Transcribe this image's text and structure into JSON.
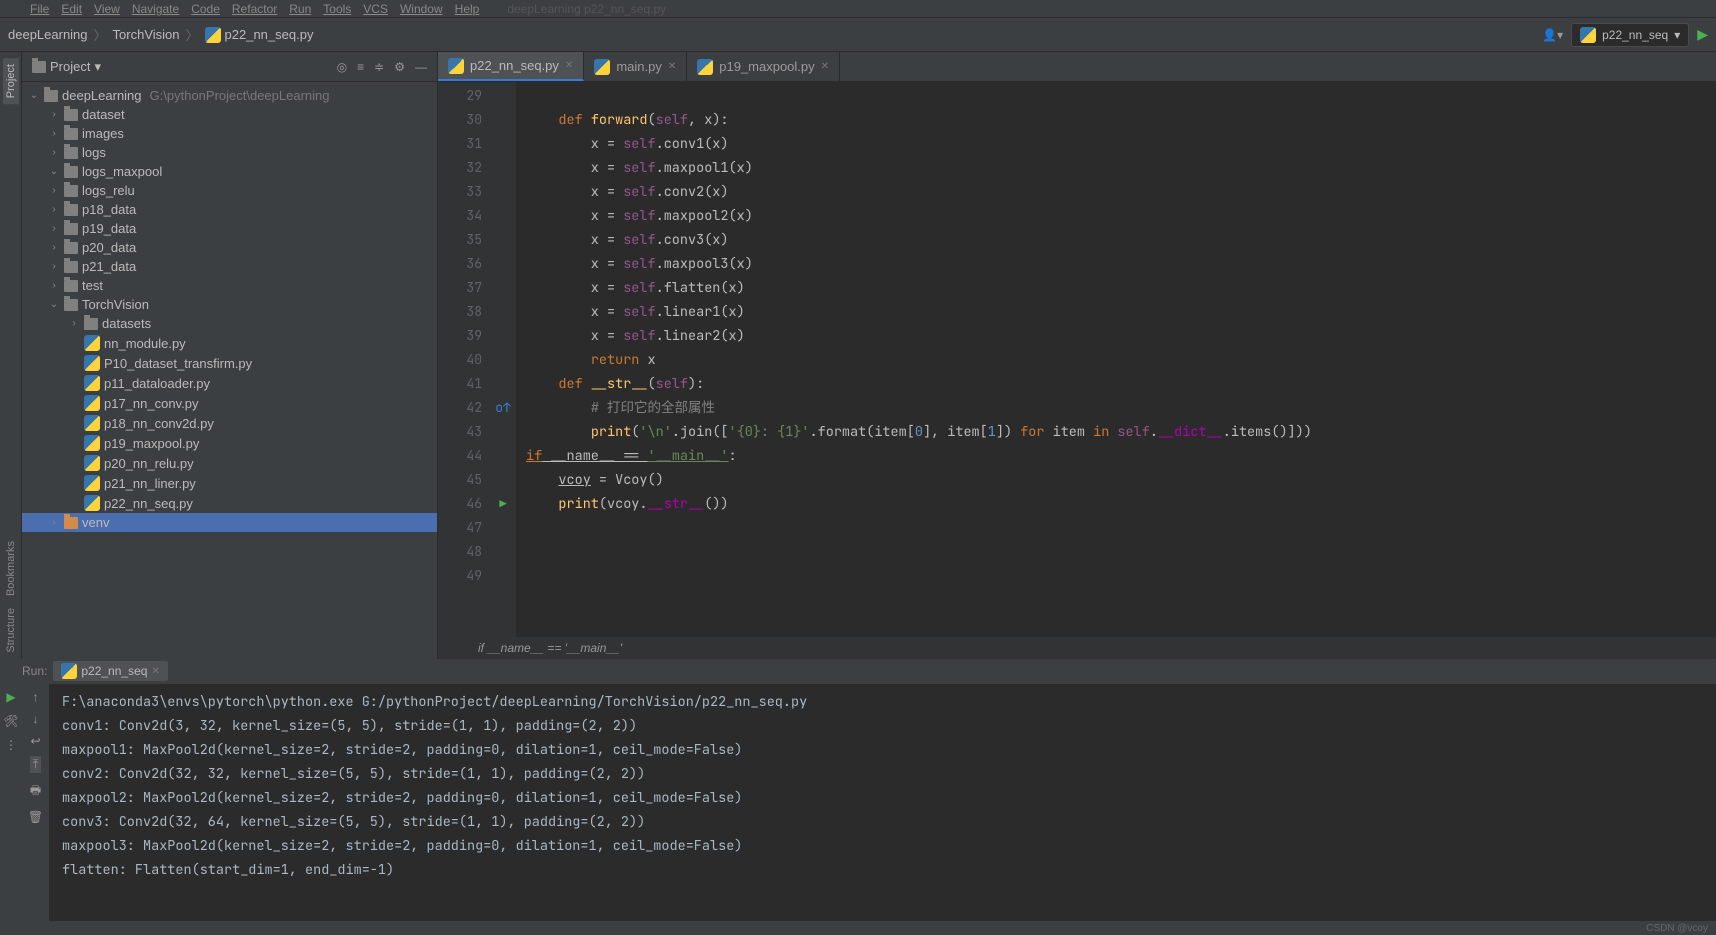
{
  "menu": [
    "File",
    "Edit",
    "View",
    "Navigate",
    "Code",
    "Refactor",
    "Run",
    "Tools",
    "VCS",
    "Window",
    "Help"
  ],
  "menu_hint": "deepLearning   p22_nn_seq.py",
  "breadcrumb": [
    "deepLearning",
    "TorchVision",
    "p22_nn_seq.py"
  ],
  "run_config": "p22_nn_seq",
  "project": {
    "header": "Project",
    "root": "deepLearning",
    "root_path": "G:\\pythonProject\\deepLearning",
    "items": [
      {
        "indent": 1,
        "type": "folder",
        "name": "dataset",
        "arrow": "›"
      },
      {
        "indent": 1,
        "type": "folder",
        "name": "images",
        "arrow": "›"
      },
      {
        "indent": 1,
        "type": "folder",
        "name": "logs",
        "arrow": "›"
      },
      {
        "indent": 1,
        "type": "folder",
        "name": "logs_maxpool",
        "arrow": "⌄"
      },
      {
        "indent": 1,
        "type": "folder",
        "name": "logs_relu",
        "arrow": "›"
      },
      {
        "indent": 1,
        "type": "folder",
        "name": "p18_data",
        "arrow": "›"
      },
      {
        "indent": 1,
        "type": "folder",
        "name": "p19_data",
        "arrow": "›"
      },
      {
        "indent": 1,
        "type": "folder",
        "name": "p20_data",
        "arrow": "›"
      },
      {
        "indent": 1,
        "type": "folder",
        "name": "p21_data",
        "arrow": "›"
      },
      {
        "indent": 1,
        "type": "folder",
        "name": "test",
        "arrow": "›"
      },
      {
        "indent": 1,
        "type": "folder",
        "name": "TorchVision",
        "arrow": "⌄"
      },
      {
        "indent": 2,
        "type": "folder",
        "name": "datasets",
        "arrow": "›"
      },
      {
        "indent": 2,
        "type": "py",
        "name": "nn_module.py"
      },
      {
        "indent": 2,
        "type": "py",
        "name": "P10_dataset_transfirm.py"
      },
      {
        "indent": 2,
        "type": "py",
        "name": "p11_dataloader.py"
      },
      {
        "indent": 2,
        "type": "py",
        "name": "p17_nn_conv.py"
      },
      {
        "indent": 2,
        "type": "py",
        "name": "p18_nn_conv2d.py"
      },
      {
        "indent": 2,
        "type": "py",
        "name": "p19_maxpool.py"
      },
      {
        "indent": 2,
        "type": "py",
        "name": "p20_nn_relu.py"
      },
      {
        "indent": 2,
        "type": "py",
        "name": "p21_nn_liner.py"
      },
      {
        "indent": 2,
        "type": "py",
        "name": "p22_nn_seq.py"
      },
      {
        "indent": 1,
        "type": "venv",
        "name": "venv",
        "arrow": "›"
      }
    ]
  },
  "editor_tabs": [
    {
      "name": "p22_nn_seq.py",
      "active": true
    },
    {
      "name": "main.py",
      "active": false
    },
    {
      "name": "p19_maxpool.py",
      "active": false
    }
  ],
  "code_lines": [
    {
      "n": 29,
      "txt": ""
    },
    {
      "n": 30,
      "html": "    <span class='kw'>def </span><span class='fn'>forward</span>(<span class='self'>self</span>, x):"
    },
    {
      "n": 31,
      "html": "        x = <span class='self'>self</span>.conv1(x)"
    },
    {
      "n": 32,
      "html": "        x = <span class='self'>self</span>.maxpool1(x)"
    },
    {
      "n": 33,
      "html": "        x = <span class='self'>self</span>.conv2(x)"
    },
    {
      "n": 34,
      "html": "        x = <span class='self'>self</span>.maxpool2(x)"
    },
    {
      "n": 35,
      "html": "        x = <span class='self'>self</span>.conv3(x)"
    },
    {
      "n": 36,
      "html": "        x = <span class='self'>self</span>.maxpool3(x)"
    },
    {
      "n": 37,
      "html": "        x = <span class='self'>self</span>.flatten(x)"
    },
    {
      "n": 38,
      "html": "        x = <span class='self'>self</span>.linear1(x)"
    },
    {
      "n": 39,
      "html": "        x = <span class='self'>self</span>.linear2(x)"
    },
    {
      "n": 40,
      "html": "        <span class='kw'>return</span> x"
    },
    {
      "n": 41,
      "html": ""
    },
    {
      "n": 42,
      "html": "    <span class='kw'>def </span><span class='fn'>__str__</span>(<span class='self'>self</span>):",
      "mark": "o↑"
    },
    {
      "n": 43,
      "html": "        <span class='cmt'># 打印它的全部属性</span>"
    },
    {
      "n": 44,
      "html": "        <span class='fn'>print</span>(<span class='str'>'\\n'</span>.join([<span class='str'>'{0}: {1}'</span>.format(item[<span class='num'>0</span>], item[<span class='num'>1</span>]) <span class='kw'>for</span> item <span class='kw'>in</span> <span class='self'>self</span>.<span class='dunder'>__dict__</span>.items()]))"
    },
    {
      "n": 45,
      "html": ""
    },
    {
      "n": 46,
      "html": "<span class='kw und'>if</span><span class='und'> __name__ == </span><span class='str und'>'__main__'</span>:",
      "run": true
    },
    {
      "n": 47,
      "html": "    <span class='und'>vcoy</span> = Vcoy()"
    },
    {
      "n": 48,
      "html": "    <span class='fn'>print</span>(vcoy.<span class='dunder'>__str__</span>())"
    },
    {
      "n": 49,
      "html": ""
    }
  ],
  "breadline": "if __name__ == '__main__'",
  "run": {
    "label": "Run:",
    "tab": "p22_nn_seq",
    "output": [
      "F:\\anaconda3\\envs\\pytorch\\python.exe G:/pythonProject/deepLearning/TorchVision/p22_nn_seq.py",
      "conv1: Conv2d(3, 32, kernel_size=(5, 5), stride=(1, 1), padding=(2, 2))",
      "maxpool1: MaxPool2d(kernel_size=2, stride=2, padding=0, dilation=1, ceil_mode=False)",
      "conv2: Conv2d(32, 32, kernel_size=(5, 5), stride=(1, 1), padding=(2, 2))",
      "maxpool2: MaxPool2d(kernel_size=2, stride=2, padding=0, dilation=1, ceil_mode=False)",
      "conv3: Conv2d(32, 64, kernel_size=(5, 5), stride=(1, 1), padding=(2, 2))",
      "maxpool3: MaxPool2d(kernel_size=2, stride=2, padding=0, dilation=1, ceil_mode=False)",
      "flatten: Flatten(start_dim=1, end_dim=-1)"
    ]
  },
  "status": "CSDN @vcoy"
}
